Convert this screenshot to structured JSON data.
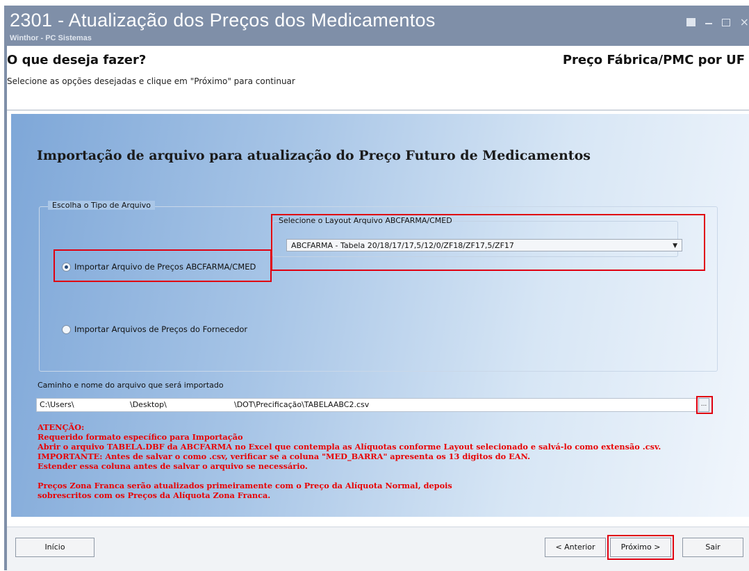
{
  "window": {
    "title": "2301 - Atualização dos Preços dos Medicamentos",
    "subtitle": "Winthor - PC Sistemas",
    "controls": [
      "restore-icon",
      "minimize-icon",
      "maximize-icon",
      "close-icon"
    ]
  },
  "header": {
    "question": "O que deseja fazer?",
    "instruction": "Selecione as opções desejadas e clique em \"Próximo\" para continuar",
    "context": "Preço Fábrica/PMC por UF"
  },
  "panel": {
    "title": "Importação de arquivo para atualização do Preço Futuro de Medicamentos",
    "file_type_group": {
      "legend": "Escolha o Tipo de Arquivo",
      "option_abcfarma": "Importar Arquivo de Preços ABCFARMA/CMED",
      "option_fornecedor": "Importar Arquivos de Preços do Fornecedor",
      "selected": "abcfarma"
    },
    "layout": {
      "legend": "Selecione o Layout Arquivo ABCFARMA/CMED",
      "selected_value": "ABCFARMA - Tabela 20/18/17/17,5/12/0/ZF18/ZF17,5/ZF17"
    },
    "path": {
      "label": "Caminho e nome do arquivo que será importado",
      "part1": "C:\\Users\\",
      "part2": "\\Desktop\\",
      "part3": "\\DOT\\Precificação\\TABELAABC2.csv",
      "browse_label": "..."
    },
    "warnings": [
      "ATENÇÃO:",
      "Requerido formato específico para Importação",
      "Abrir o arquivo TABELA.DBF da ABCFARMA no Excel que contempla as Alíquotas conforme Layout selecionado e salvá-lo como extensão .csv.",
      "IMPORTANTE: Antes de salvar o como .csv, verificar se a coluna \"MED_BARRA\" apresenta os 13 digitos do EAN.",
      "Estender essa coluna antes de salvar o arquivo se necessário.",
      "",
      "Preços Zona Franca serão atualizados primeiramente com o Preço da Alíquota Normal, depois",
      "sobrescritos com os Preços da Alíquota Zona Franca."
    ],
    "warning_color": "#e80000"
  },
  "footer": {
    "inicio": "Início",
    "anterior": "< Anterior",
    "proximo": "Próximo >",
    "sair": "Sair"
  },
  "highlight_color": "#e00010"
}
